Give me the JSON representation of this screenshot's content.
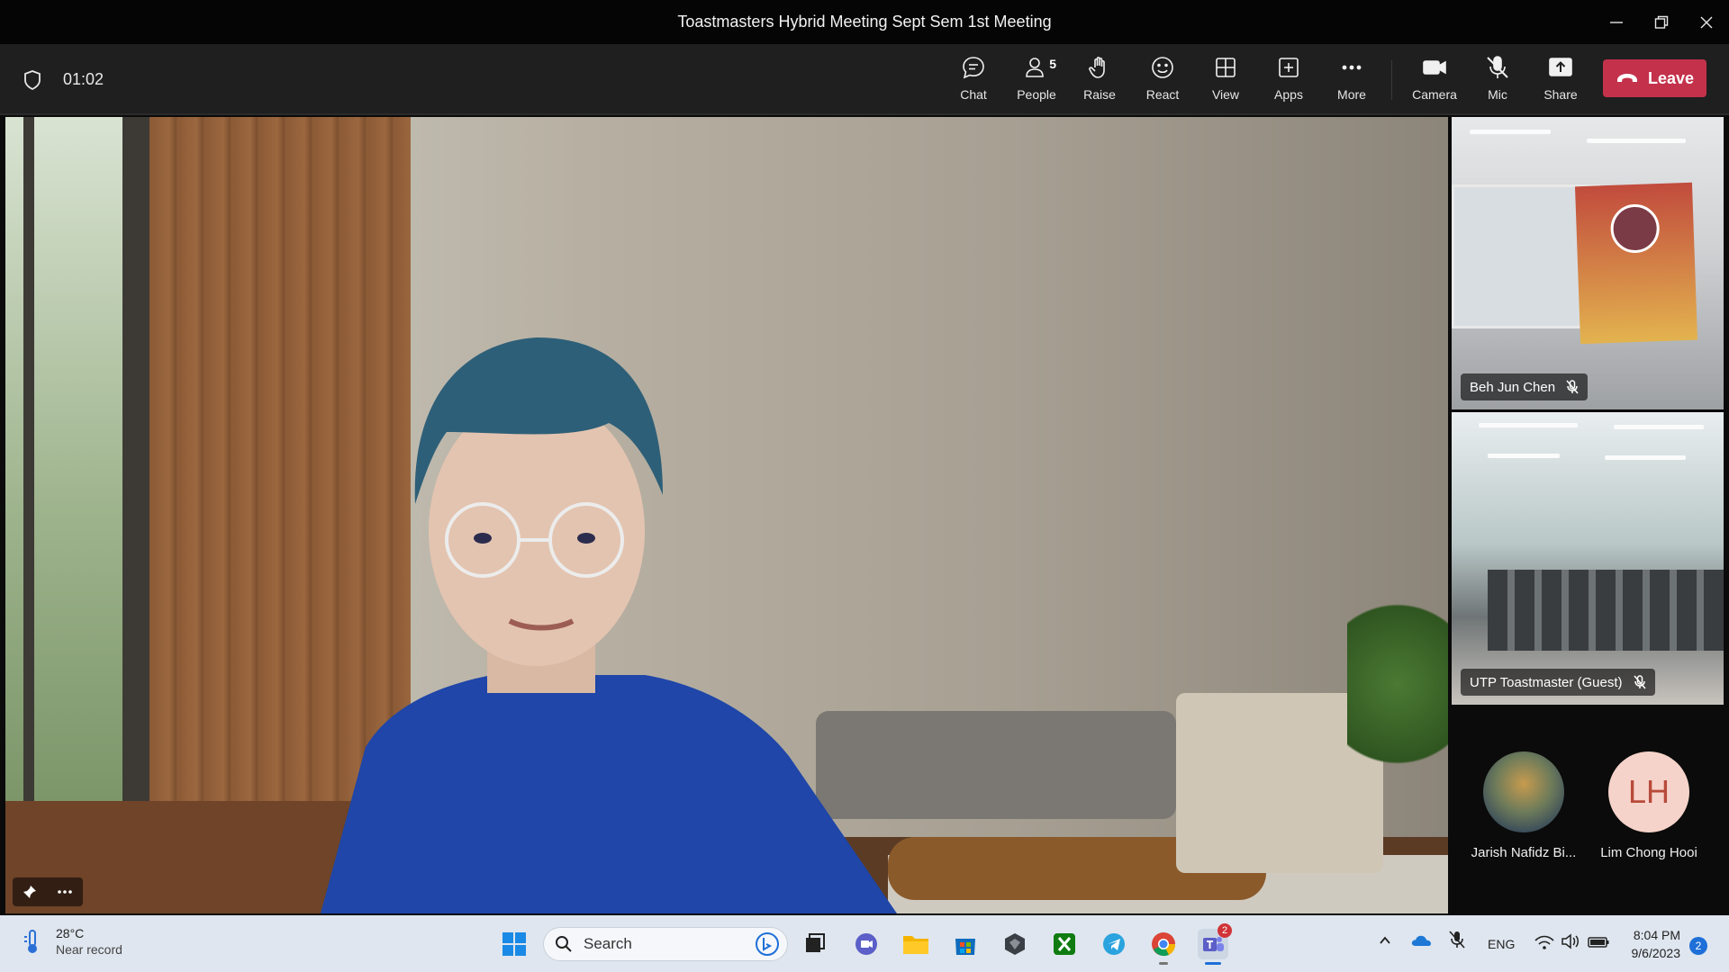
{
  "window": {
    "title": "Toastmasters Hybrid Meeting Sept Sem 1st Meeting"
  },
  "toolbar": {
    "timer": "01:02",
    "buttons": {
      "chat": "Chat",
      "people": "People",
      "people_count": "5",
      "raise": "Raise",
      "react": "React",
      "view": "View",
      "apps": "Apps",
      "more": "More",
      "camera": "Camera",
      "mic": "Mic",
      "share": "Share",
      "leave": "Leave"
    },
    "leave_color": "#c4314b"
  },
  "participants": {
    "tiles": [
      {
        "name": "Beh Jun Chen",
        "muted": true
      },
      {
        "name": "UTP Toastmaster (Guest)",
        "muted": true
      }
    ],
    "avatars": [
      {
        "name": "Jarish Nafidz Bi...",
        "type": "photo"
      },
      {
        "name": "Lim Chong Hooi",
        "type": "initials",
        "initials": "LH"
      }
    ]
  },
  "taskbar": {
    "weather": {
      "temp": "28°C",
      "condition": "Near record"
    },
    "search_placeholder": "Search",
    "apps": [
      "windows-start-icon",
      "task-view-icon",
      "meet-now-icon",
      "file-explorer-icon",
      "microsoft-store-icon",
      "obs-icon",
      "xbox-icon",
      "telegram-icon",
      "chrome-icon",
      "teams-icon"
    ],
    "teams_badge": "2",
    "language": "ENG",
    "time": "8:04 PM",
    "date": "9/6/2023",
    "notifications": "2"
  }
}
